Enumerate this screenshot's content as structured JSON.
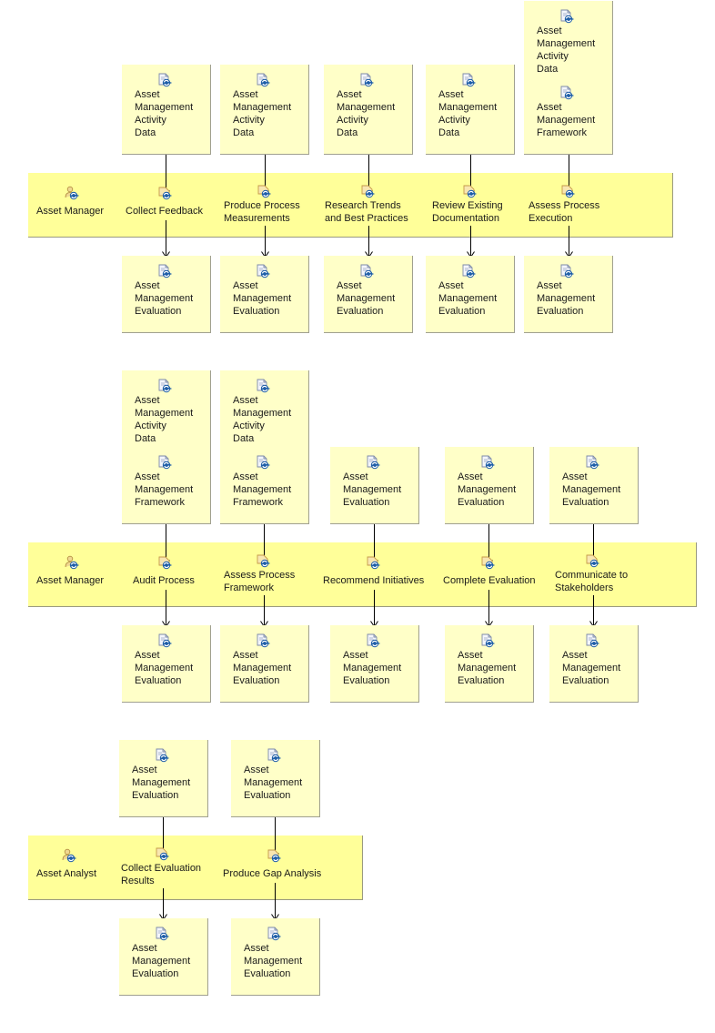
{
  "diagram": {
    "sections": [
      {
        "role": {
          "label": "Asset Manager",
          "icon": "role-icon"
        },
        "tasks": [
          {
            "label": "Collect Feedback",
            "inputs": [
              "Asset Management Activity Data"
            ],
            "outputs": [
              "Asset Management Evaluation"
            ]
          },
          {
            "label": "Produce Process\nMeasurements",
            "inputs": [
              "Asset Management Activity Data"
            ],
            "outputs": [
              "Asset Management Evaluation"
            ]
          },
          {
            "label": "Research Trends\nand Best Practices",
            "inputs": [
              "Asset Management Activity Data"
            ],
            "outputs": [
              "Asset Management Evaluation"
            ]
          },
          {
            "label": "Review Existing\nDocumentation",
            "inputs": [
              "Asset Management Activity Data"
            ],
            "outputs": [
              "Asset Management Evaluation"
            ]
          },
          {
            "label": "Assess Process\nExecution",
            "inputs": [
              "Asset Management Activity Data",
              "Asset Management Framework"
            ],
            "outputs": [
              "Asset Management Evaluation"
            ]
          }
        ]
      },
      {
        "role": {
          "label": "Asset Manager",
          "icon": "role-icon"
        },
        "tasks": [
          {
            "label": "Audit Process",
            "inputs": [
              "Asset Management Activity Data",
              "Asset Management Framework"
            ],
            "outputs": [
              "Asset Management Evaluation"
            ]
          },
          {
            "label": "Assess Process\nFramework",
            "inputs": [
              "Asset Management Activity Data",
              "Asset Management Framework"
            ],
            "outputs": [
              "Asset Management Evaluation"
            ]
          },
          {
            "label": "Recommend Initiatives",
            "inputs": [
              "Asset Management Evaluation"
            ],
            "outputs": [
              "Asset Management Evaluation"
            ]
          },
          {
            "label": "Complete Evaluation",
            "inputs": [
              "Asset Management Evaluation"
            ],
            "outputs": [
              "Asset Management Evaluation"
            ]
          },
          {
            "label": "Communicate to\nStakeholders",
            "inputs": [
              "Asset Management Evaluation"
            ],
            "outputs": [
              "Asset Management Evaluation"
            ]
          }
        ]
      },
      {
        "role": {
          "label": "Asset Analyst",
          "icon": "role-icon"
        },
        "tasks": [
          {
            "label": "Collect Evaluation\nResults",
            "inputs": [
              "Asset Management Evaluation"
            ],
            "outputs": [
              "Asset Management Evaluation"
            ]
          },
          {
            "label": "Produce Gap Analysis",
            "inputs": [
              "Asset Management Evaluation"
            ],
            "outputs": [
              "Asset Management Evaluation"
            ]
          }
        ]
      }
    ],
    "artifact_label_lines": {
      "Asset Management Activity Data": "Asset\nManagement\nActivity\nData",
      "Asset Management Framework": "Asset\nManagement\nFramework",
      "Asset Management Evaluation": "Asset\nManagement\nEvaluation"
    },
    "colors": {
      "lane_fill": "#ffff99",
      "artifact_fill": "#ffffc8",
      "edge": "#000000",
      "icon_blue": "#1f5fa8"
    }
  }
}
